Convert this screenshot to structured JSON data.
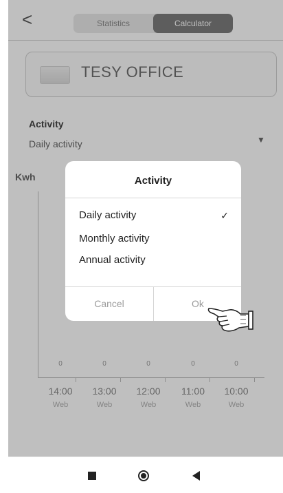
{
  "header": {
    "back_glyph": "<",
    "tabs": [
      {
        "label": "Statistics",
        "active": false
      },
      {
        "label": "Calculator",
        "active": true
      }
    ]
  },
  "device": {
    "name": "TESY OFFICE"
  },
  "activity": {
    "label": "Activity",
    "value": "Daily activity",
    "dropdown_glyph": "▼"
  },
  "chart": {
    "unit": "Kwh",
    "columns": [
      {
        "value": "0",
        "time": "14:00",
        "sub": "Web"
      },
      {
        "value": "0",
        "time": "13:00",
        "sub": "Web"
      },
      {
        "value": "0",
        "time": "12:00",
        "sub": "Web"
      },
      {
        "value": "0",
        "time": "11:00",
        "sub": "Web"
      },
      {
        "value": "0",
        "time": "10:00",
        "sub": "Web"
      }
    ]
  },
  "dialog": {
    "title": "Activity",
    "options": [
      {
        "label": "Daily activity",
        "checked": true,
        "check_glyph": "✓"
      },
      {
        "label": "Monthly activity",
        "checked": false,
        "check_glyph": ""
      },
      {
        "label": "Annual activity",
        "checked": false,
        "check_glyph": ""
      }
    ],
    "cancel_label": "Cancel",
    "ok_label": "Ok"
  },
  "colors": {
    "scrim": "#00000040",
    "active_tab": "#7d7d7d"
  },
  "icons": {
    "pointer": "pointing-hand-icon",
    "nav_recents": "square-icon",
    "nav_home": "circle-icon",
    "nav_back": "triangle-back-icon"
  }
}
